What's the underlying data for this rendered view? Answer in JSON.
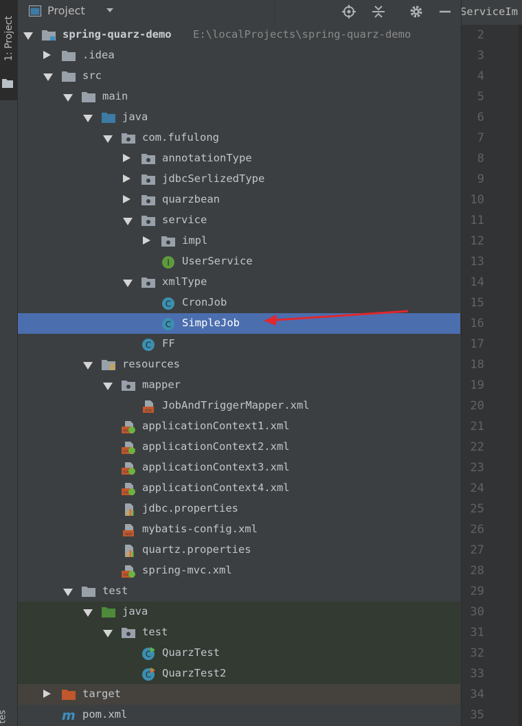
{
  "stripe": {
    "label": "1: Project",
    "bottom_label": "tes"
  },
  "header": {
    "title": "Project"
  },
  "editor": {
    "tab_title": "ServiceIm"
  },
  "tree": [
    {
      "label": "spring-quarz-demo",
      "path": "E:\\localProjects\\spring-quarz-demo",
      "depth": 0,
      "arrow": "down",
      "icon": "module-folder-icon",
      "bold": true
    },
    {
      "label": ".idea",
      "depth": 1,
      "arrow": "right",
      "icon": "folder-icon"
    },
    {
      "label": "src",
      "depth": 1,
      "arrow": "down",
      "icon": "folder-icon"
    },
    {
      "label": "main",
      "depth": 2,
      "arrow": "down",
      "icon": "folder-icon"
    },
    {
      "label": "java",
      "depth": 3,
      "arrow": "down",
      "icon": "source-folder-icon"
    },
    {
      "label": "com.fufulong",
      "depth": 4,
      "arrow": "down",
      "icon": "package-icon"
    },
    {
      "label": "annotationType",
      "depth": 5,
      "arrow": "right",
      "icon": "package-icon"
    },
    {
      "label": "jdbcSerlizedType",
      "depth": 5,
      "arrow": "right",
      "icon": "package-icon"
    },
    {
      "label": "quarzbean",
      "depth": 5,
      "arrow": "right",
      "icon": "package-icon"
    },
    {
      "label": "service",
      "depth": 5,
      "arrow": "down",
      "icon": "package-icon"
    },
    {
      "label": "impl",
      "depth": 6,
      "arrow": "right",
      "icon": "package-icon"
    },
    {
      "label": "UserService",
      "depth": 6,
      "arrow": "none",
      "icon": "interface-icon"
    },
    {
      "label": "xmlType",
      "depth": 5,
      "arrow": "down",
      "icon": "package-icon"
    },
    {
      "label": "CronJob",
      "depth": 6,
      "arrow": "none",
      "icon": "class-icon"
    },
    {
      "label": "SimpleJob",
      "depth": 6,
      "arrow": "none",
      "icon": "class-icon",
      "selected": true
    },
    {
      "label": "FF",
      "depth": 5,
      "arrow": "none",
      "icon": "class-icon"
    },
    {
      "label": "resources",
      "depth": 3,
      "arrow": "down",
      "icon": "resources-folder-icon"
    },
    {
      "label": "mapper",
      "depth": 4,
      "arrow": "down",
      "icon": "package-icon"
    },
    {
      "label": "JobAndTriggerMapper.xml",
      "depth": 5,
      "arrow": "none",
      "icon": "xml-file-icon"
    },
    {
      "label": "applicationContext1.xml",
      "depth": 4,
      "arrow": "none",
      "icon": "spring-xml-icon"
    },
    {
      "label": "applicationContext2.xml",
      "depth": 4,
      "arrow": "none",
      "icon": "spring-xml-icon"
    },
    {
      "label": "applicationContext3.xml",
      "depth": 4,
      "arrow": "none",
      "icon": "spring-xml-icon"
    },
    {
      "label": "applicationContext4.xml",
      "depth": 4,
      "arrow": "none",
      "icon": "spring-xml-icon"
    },
    {
      "label": "jdbc.properties",
      "depth": 4,
      "arrow": "none",
      "icon": "properties-file-icon"
    },
    {
      "label": "mybatis-config.xml",
      "depth": 4,
      "arrow": "none",
      "icon": "xml-file-icon"
    },
    {
      "label": "quartz.properties",
      "depth": 4,
      "arrow": "none",
      "icon": "properties-file-icon"
    },
    {
      "label": "spring-mvc.xml",
      "depth": 4,
      "arrow": "none",
      "icon": "spring-xml-icon"
    },
    {
      "label": "test",
      "depth": 2,
      "arrow": "down",
      "icon": "folder-icon"
    },
    {
      "label": "java",
      "depth": 3,
      "arrow": "down",
      "icon": "test-folder-icon",
      "zone": "test"
    },
    {
      "label": "test",
      "depth": 4,
      "arrow": "down",
      "icon": "package-icon",
      "zone": "test"
    },
    {
      "label": "QuarzTest",
      "depth": 5,
      "arrow": "none",
      "icon": "test-class-icon",
      "zone": "test"
    },
    {
      "label": "QuarzTest2",
      "depth": 5,
      "arrow": "none",
      "icon": "test-class-warn-icon",
      "zone": "test"
    },
    {
      "label": "target",
      "depth": 1,
      "arrow": "right",
      "icon": "excluded-folder-icon",
      "zone": "excluded"
    },
    {
      "label": "pom.xml",
      "depth": 1,
      "arrow": "none",
      "icon": "maven-icon"
    }
  ],
  "line_numbers": [
    "2",
    "3",
    "4",
    "5",
    "6",
    "7",
    "8",
    "9",
    "10",
    "11",
    "12",
    "13",
    "14",
    "15",
    "16",
    "17",
    "18",
    "19",
    "20",
    "21",
    "22",
    "23",
    "24",
    "25",
    "26",
    "27",
    "28",
    "29",
    "30",
    "31",
    "32",
    "33",
    "34",
    "35"
  ],
  "colors": {
    "selection": "#4b6eaf",
    "annotation_arrow": "#e0282e",
    "class_icon": "#3d8fb0",
    "interface_icon": "#5e9a3d"
  }
}
